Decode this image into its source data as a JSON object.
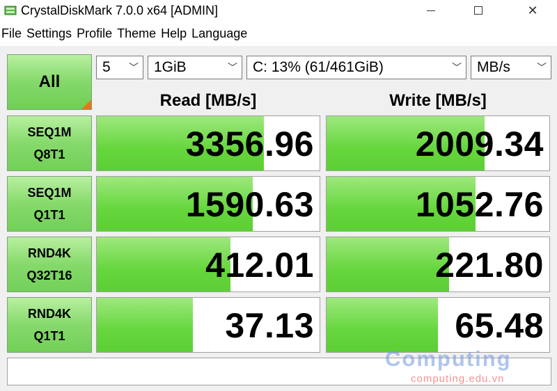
{
  "window": {
    "title": "CrystalDiskMark 7.0.0 x64 [ADMIN]"
  },
  "menu": [
    "File",
    "Settings",
    "Profile",
    "Theme",
    "Help",
    "Language"
  ],
  "controls": {
    "all_label": "All",
    "count": "5",
    "size": "1GiB",
    "drive": "C: 13% (61/461GiB)",
    "unit": "MB/s"
  },
  "columns": {
    "read": "Read [MB/s]",
    "write": "Write [MB/s]"
  },
  "tests": [
    {
      "line1": "SEQ1M",
      "line2": "Q8T1",
      "read": "3356.96",
      "write": "2009.34",
      "read_fill": 0.75,
      "write_fill": 0.71
    },
    {
      "line1": "SEQ1M",
      "line2": "Q1T1",
      "read": "1590.63",
      "write": "1052.76",
      "read_fill": 0.7,
      "write_fill": 0.67
    },
    {
      "line1": "RND4K",
      "line2": "Q32T16",
      "read": "412.01",
      "write": "221.80",
      "read_fill": 0.6,
      "write_fill": 0.55
    },
    {
      "line1": "RND4K",
      "line2": "Q1T1",
      "read": "37.13",
      "write": "65.48",
      "read_fill": 0.43,
      "write_fill": 0.5
    }
  ],
  "comment": "",
  "watermark": {
    "logo": "Computing",
    "url": "computing.edu.vn"
  },
  "colors": {
    "accent_green": "#66d63d",
    "corner_orange": "#e8761a"
  },
  "icons": {
    "app": "disk-icon",
    "dropdown": "chevron-down-icon"
  }
}
